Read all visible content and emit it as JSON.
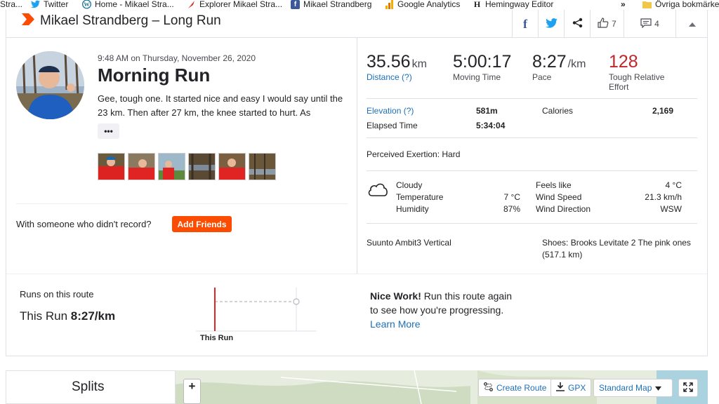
{
  "bookmarks": [
    {
      "label": "Stra...",
      "icon": "globe-icon"
    },
    {
      "label": "Twitter",
      "icon": "twitter-icon"
    },
    {
      "label": "Home - Mikael Stra...",
      "icon": "wordpress-icon"
    },
    {
      "label": "Explorer Mikael Stra...",
      "icon": "feather-icon"
    },
    {
      "label": "Mikael Strandberg",
      "icon": "facebook-icon"
    },
    {
      "label": "Google Analytics",
      "icon": "analytics-icon"
    },
    {
      "label": "Hemingway Editor",
      "icon": "hemingway-icon"
    }
  ],
  "bookmarks_overflow": "»",
  "bookmarks_other": "Övriga bokmärke",
  "header": {
    "title": "Mikael Strandberg – Long Run",
    "kudos_count": "7",
    "comments_count": "4"
  },
  "activity": {
    "datetime": "9:48 AM on Thursday, November 26, 2020",
    "name": "Morning Run",
    "description": "Gee, tough one. It started nice and easy I would say until the 23 km. Then after 27 km, the knee started to hurt. As",
    "more_label": "•••",
    "friends_text": "With someone who didn't record?",
    "add_friends_label": "Add Friends"
  },
  "stats": {
    "distance_value": "35.56",
    "distance_unit": "km",
    "distance_label": "Distance (?)",
    "moving_time_value": "5:00:17",
    "moving_time_label": "Moving Time",
    "pace_value": "8:27",
    "pace_unit": "/km",
    "pace_label": "Pace",
    "effort_value": "128",
    "effort_label_1": "Tough Relative",
    "effort_label_2": "Effort",
    "elevation_label": "Elevation (?)",
    "elevation_value": "581m",
    "calories_label": "Calories",
    "calories_value": "2,169",
    "elapsed_label": "Elapsed Time",
    "elapsed_value": "5:34:04",
    "exertion": "Perceived Exertion: Hard"
  },
  "weather": {
    "condition": "Cloudy",
    "temperature_label": "Temperature",
    "temperature_value": "7 °C",
    "humidity_label": "Humidity",
    "humidity_value": "87%",
    "feels_like_label": "Feels like",
    "feels_like_value": "4 °C",
    "wind_speed_label": "Wind Speed",
    "wind_speed_value": "21.3 km/h",
    "wind_direction_label": "Wind Direction",
    "wind_direction_value": "WSW"
  },
  "gear": {
    "device": "Suunto Ambit3 Vertical",
    "shoes_line1": "Shoes: Brooks Levitate 2 The pink ones",
    "shoes_line2": "(517.1 km)"
  },
  "route": {
    "title": "Runs on this route",
    "this_run_prefix": "This Run ",
    "this_run_pace": "8:27/km",
    "chart_label": "This Run",
    "nice_work_bold": "Nice Work!",
    "nice_work_line1": " Run this route again",
    "nice_work_line2": "to see how you're progressing.",
    "learn_more": "Learn More"
  },
  "bottom": {
    "splits_title": "Splits",
    "zoom_in": "+",
    "create_route": "Create Route",
    "gpx": "GPX",
    "map_style": "Standard Map"
  },
  "colors": {
    "accent": "#fc4c02",
    "link": "#1d70b8",
    "effort": "#c0272d"
  }
}
